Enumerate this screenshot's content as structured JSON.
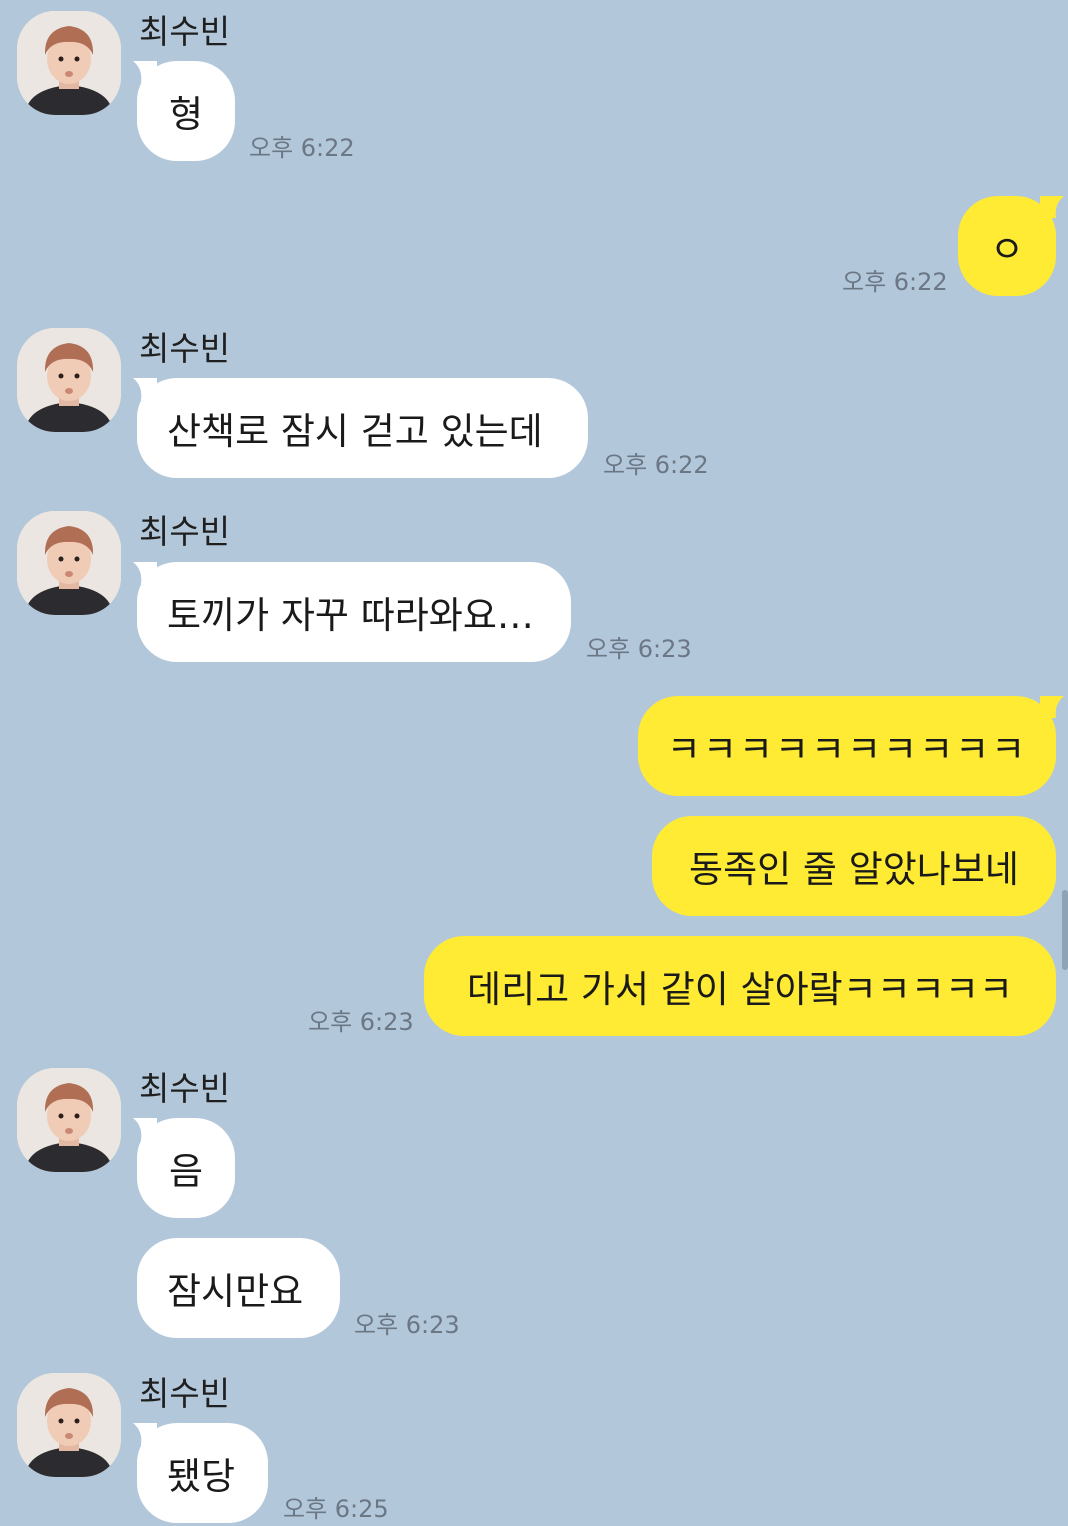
{
  "sender": {
    "name": "최수빈"
  },
  "messages": [
    {
      "from": "them",
      "text": "형",
      "time": "오후 6:22"
    },
    {
      "from": "me",
      "text": "ㅇ",
      "time": "오후 6:22"
    },
    {
      "from": "them",
      "text": "산책로 잠시 걷고 있는데",
      "time": "오후 6:22"
    },
    {
      "from": "them",
      "text": "토끼가 자꾸 따라와요…",
      "time": "오후 6:23"
    },
    {
      "from": "me",
      "text": "ㅋㅋㅋㅋㅋㅋㅋㅋㅋㅋ"
    },
    {
      "from": "me",
      "text": "동족인 줄 알았나보네"
    },
    {
      "from": "me",
      "text": "데리고 가서 같이 살아랔ㅋㅋㅋㅋㅋ",
      "time": "오후 6:23"
    },
    {
      "from": "them",
      "text": "음"
    },
    {
      "from": "them",
      "text": "잠시만요",
      "time": "오후 6:23"
    },
    {
      "from": "them",
      "text": "됐당",
      "time": "오후 6:25"
    }
  ],
  "colors": {
    "background": "#b2c7da",
    "incoming_bubble": "#ffffff",
    "outgoing_bubble": "#ffeb33",
    "timestamp": "#6b7785"
  },
  "icons": {
    "avatar": "profile-photo"
  }
}
